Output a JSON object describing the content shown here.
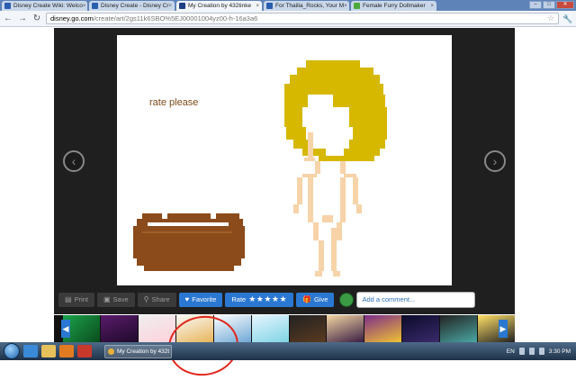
{
  "browser": {
    "tabs": [
      {
        "title": "Disney Create Wiki: Welco",
        "active": false,
        "icon": "disney-favicon-icon"
      },
      {
        "title": "Disney Create - Disney Cr",
        "active": false,
        "icon": "disney-favicon-icon"
      },
      {
        "title": "My Creation by 432tinke",
        "active": true,
        "icon": "disney-favicon-icon"
      },
      {
        "title": "For Thailia_Rocks, Your M",
        "active": false,
        "icon": "disney-favicon-icon"
      },
      {
        "title": "Female Furry Dollmaker",
        "active": false,
        "icon": "dollmaker-favicon-icon"
      }
    ],
    "tab_close": "×",
    "window_buttons": {
      "minimize": "–",
      "maximize": "□",
      "close": "✕"
    },
    "nav": {
      "back": "←",
      "forward": "→",
      "reload": "↻"
    },
    "url": {
      "host": "disney.go.com",
      "path": "/create/art/2gs11k6SBO%5EJ00001004yz00-h-16a3a6"
    },
    "bookmark_star": "☆",
    "wrench": "🔧"
  },
  "creation": {
    "caption": "rate please",
    "prev_arrow": "‹",
    "next_arrow": "›"
  },
  "actions": {
    "print": "Print",
    "save": "Save",
    "share": "Share",
    "favorite": "Favorite",
    "rate": "Rate",
    "rate_stars": "★★★★★",
    "give": "Give",
    "comment_placeholder": "Add a comment..."
  },
  "strip_nav": {
    "left": "◀",
    "right": "▶"
  },
  "taskbar": {
    "active_window": "My Creation by 432t",
    "lang": "EN",
    "time": "3:30 PM"
  },
  "colors": {
    "hair": "#d6b800",
    "skin": "#f6d3a8",
    "cake": "#8b4b1a",
    "frosting": "#ffffff",
    "caption": "#7a4a16",
    "button_blue": "#2a78d1",
    "highlight_circle": "#e0261c"
  }
}
